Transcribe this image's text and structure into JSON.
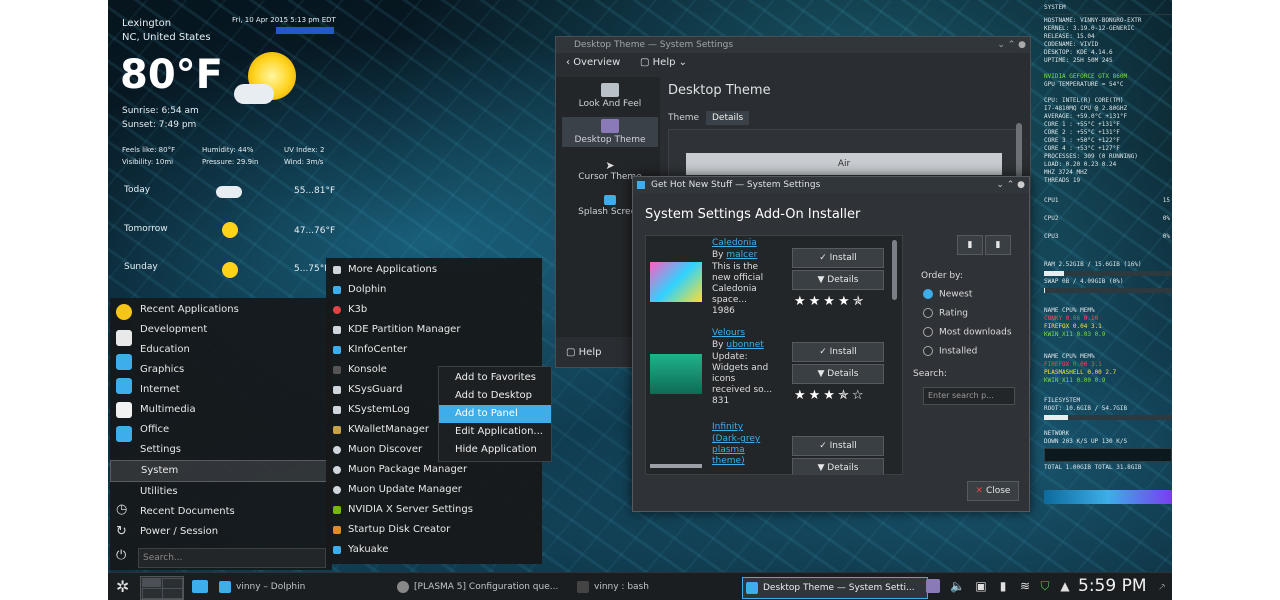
{
  "weather": {
    "city": "Lexington",
    "region": "NC,   United States",
    "datetime": "Fri, 10 Apr 2015 5:13 pm EDT",
    "temp": "80°F",
    "sunrise": "Sunrise: 6:54 am",
    "sunset": "Sunset: 7:49 pm",
    "feels_like": "Feels like: 80°F",
    "humidity": "Humidity: 44%",
    "uv": "UV Index: 2",
    "visibility": "Visibility: 10mi",
    "pressure": "Pressure: 29.9in",
    "wind": "Wind: 3m/s",
    "forecast": [
      {
        "day": "Today",
        "range": "55...81°F"
      },
      {
        "day": "Tomorrow",
        "range": "47...76°F"
      },
      {
        "day": "Sunday",
        "range": "5...75°F"
      }
    ]
  },
  "menu": {
    "categories": [
      "Recent Applications",
      "Development",
      "Education",
      "Graphics",
      "Internet",
      "Multimedia",
      "Office",
      "Settings",
      "System",
      "Utilities",
      "Recent Documents",
      "Power / Session"
    ],
    "search_placeholder": "Search...",
    "system_apps": [
      "More Applications",
      "Dolphin",
      "K3b",
      "KDE Partition Manager",
      "KInfoCenter",
      "Konsole",
      "KSysGuard",
      "KSystemLog",
      "KWalletManager",
      "Muon Discover",
      "Muon Package Manager",
      "Muon Update Manager",
      "NVIDIA X Server Settings",
      "Startup Disk Creator",
      "Yakuake"
    ],
    "context": [
      "Add to Favorites",
      "Add to Desktop",
      "Add to Panel",
      "Edit Application...",
      "Hide Application"
    ]
  },
  "settings_window": {
    "title": "Desktop Theme — System Settings",
    "overview": "Overview",
    "help_top": "Help",
    "sidebar": [
      "Look And Feel",
      "Desktop Theme",
      "Cursor Theme",
      "Splash Screen"
    ],
    "heading": "Desktop Theme",
    "tabs": [
      "Theme",
      "Details"
    ],
    "air_label": "Air",
    "help_bottom": "Help"
  },
  "ghns": {
    "title": "Get Hot New Stuff — System Settings",
    "heading": "System Settings Add-On Installer",
    "items": [
      {
        "name": "Caledonia",
        "by": "By",
        "author": "malcer",
        "desc": [
          "This is the",
          "new official",
          "Caledonia",
          "space...",
          "1986"
        ],
        "stars": "★★★★✯"
      },
      {
        "name": "Velours",
        "by": "By",
        "author": "ubonnet",
        "desc": [
          "Update:",
          "Widgets and",
          "icons",
          "received so...",
          "831"
        ],
        "stars": "★★★✯☆"
      },
      {
        "name": "Infinity",
        "by": "",
        "author": "",
        "desc": [
          "(Dark-grey",
          "plasma",
          "theme)"
        ],
        "stars": ""
      }
    ],
    "install": "✓ Install",
    "details": "Details",
    "order_by": "Order by:",
    "orders": [
      "Newest",
      "Rating",
      "Most downloads",
      "Installed"
    ],
    "search_label": "Search:",
    "search_placeholder": "Enter search p...",
    "close": "Close"
  },
  "conky": {
    "header": "SYSTEM",
    "lines": [
      "HOSTNAME:  VINNY-BONGRO-EXTR",
      "KERNEL:   3.19.0-12-GENERIC",
      "RELEASE:              15.04",
      "CODENAME:             VIVID",
      "DESKTOP:          KDE 4.14.6",
      "UPTIME:          25H 50M 24S",
      "",
      "NVIDIA  GEFORCE GTX 860M",
      "GPU TEMPERATURE = 54°C",
      "",
      "CPU: INTEL(R) CORE(TM)",
      "I7-4810MQ CPU @ 2.80GHZ",
      "AVERAGE:  +59.0°C  +131°F",
      "CORE 1 :   +55°C   +131°F",
      "CORE 2 :   +55°C   +131°F",
      "CORE 3 :   +50°C   +122°F",
      "CORE 4 :   +53°C   +127°F",
      "PROCESSES:  309 (0 RUNNING)",
      "LOAD:           0.20 0.23 0.24",
      "MHZ                     3724 MHZ",
      "THREADS                      19"
    ],
    "cpu_rows": [
      {
        "label": "CPU1",
        "value": "15"
      },
      {
        "label": "CPU2",
        "value": "0%"
      },
      {
        "label": "CPU3",
        "value": "0%"
      }
    ],
    "ram": "RAM  2.52GIB / 15.6GIB (16%)",
    "swap": "SWAP   0B  / 4.09GIB (0%)",
    "top_cpu_header": "NAME          CPU%  MEM%",
    "top_cpu": [
      "CONKY     0.06  0.10",
      "FIREFOX   0.04  3.1",
      "KWIN_X11  0.03  0.9"
    ],
    "top_mem_header": "NAME          CPU%  MEM%",
    "top_mem": [
      "FIREFOX   0.00  3.1",
      "PLASMASHELL 0.00  2.7",
      "KWIN_X11  0.00  0.9"
    ],
    "filesystem": "FILESYSTEM",
    "root": "ROOT:  10.6GIB / 54.7GIB",
    "network": "NETWORK",
    "down_up": "DOWN 203   K/S  UP 130  K/S",
    "totals": "TOTAL 1.00GIB   TOTAL 31.8GIB"
  },
  "taskbar": {
    "tasks": [
      "vinny – Dolphin",
      "[PLASMA 5] Configuration que...",
      "vinny : bash",
      "Desktop Theme — System Setti..."
    ],
    "clock": "5:59 PM"
  }
}
